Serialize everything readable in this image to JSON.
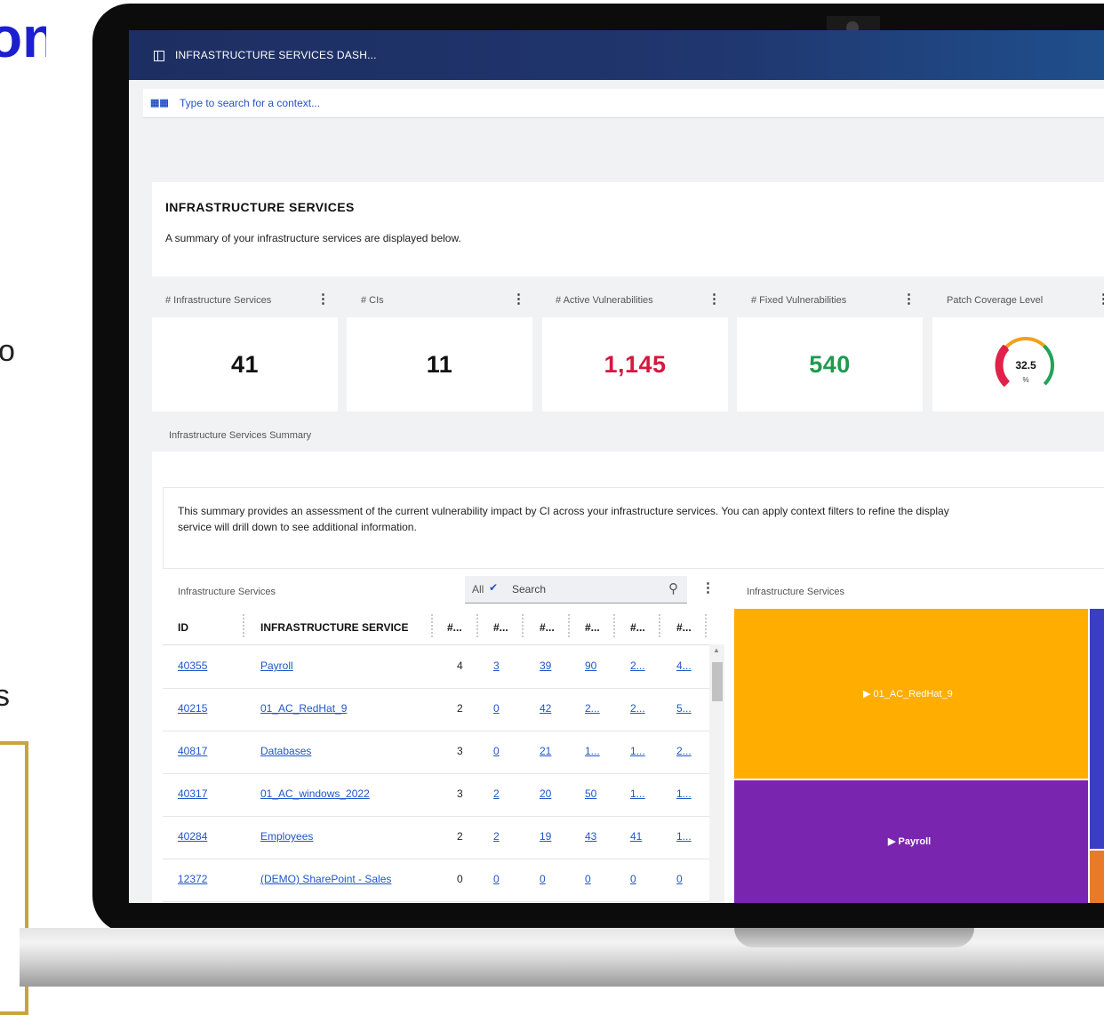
{
  "slide": {
    "heading_fragment": "on",
    "text_fragment_1": "o",
    "text_fragment_2": "s"
  },
  "window": {
    "title": "INFRASTRUCTURE SERVICES DASH..."
  },
  "context_bar": {
    "placeholder": "Type to search for a context..."
  },
  "header": {
    "title": "INFRASTRUCTURE SERVICES",
    "subtitle": "A summary of your infrastructure services are displayed below."
  },
  "kpis": [
    {
      "label": "# Infrastructure Services",
      "value": "41",
      "color": "#111111"
    },
    {
      "label": "# CIs",
      "value": "11",
      "color": "#111111"
    },
    {
      "label": "# Active Vulnerabilities",
      "value": "1,145",
      "color": "#d8173f"
    },
    {
      "label": "# Fixed Vulnerabilities",
      "value": "540",
      "color": "#1f9a4f"
    },
    {
      "label": "Patch Coverage Level",
      "value": "32.5",
      "unit": "%",
      "gauge_fraction": 0.325
    }
  ],
  "summary": {
    "section_label": "Infrastructure Services Summary",
    "description_line1": "This summary provides an assessment of the current vulnerability impact by CI across your infrastructure services. You can apply context filters to refine the display",
    "description_line2": "service will drill down to see additional information."
  },
  "table_panel": {
    "label": "Infrastructure Services",
    "filter_value": "All",
    "search_placeholder": "Search",
    "columns": [
      "ID",
      "INFRASTRUCTURE SERVICE",
      "#...",
      "#...",
      "#...",
      "#...",
      "#...",
      "#..."
    ],
    "rows": [
      [
        "40355",
        "Payroll",
        "4",
        "3",
        "39",
        "90",
        "2...",
        "4..."
      ],
      [
        "40215",
        "01_AC_RedHat_9",
        "2",
        "0",
        "42",
        "2...",
        "2...",
        "5..."
      ],
      [
        "40817",
        "Databases",
        "3",
        "0",
        "21",
        "1...",
        "1...",
        "2..."
      ],
      [
        "40317",
        "01_AC_windows_2022",
        "3",
        "2",
        "20",
        "50",
        "1...",
        "1..."
      ],
      [
        "40284",
        "Employees",
        "2",
        "2",
        "19",
        "43",
        "41",
        "1..."
      ],
      [
        "12372",
        "(DEMO) SharePoint - Sales",
        "0",
        "0",
        "0",
        "0",
        "0",
        "0"
      ]
    ]
  },
  "treemap_panel": {
    "label": "Infrastructure Services",
    "tiles": [
      {
        "label": "▶ 01_AC_RedHat_9",
        "color": "#ffad00"
      },
      {
        "label": "▶ Payroll",
        "color": "#7a25b0"
      },
      {
        "label": "",
        "color": "#3a3ec4"
      },
      {
        "label": "",
        "color": "#e87b2a"
      }
    ]
  },
  "icons": {
    "window": "window-icon",
    "context": "context-grid-icon",
    "more": "kebab-menu-icon",
    "chevron": "chevron-down-icon",
    "search": "magnifier-icon",
    "arrow": "play-triangle-icon"
  }
}
